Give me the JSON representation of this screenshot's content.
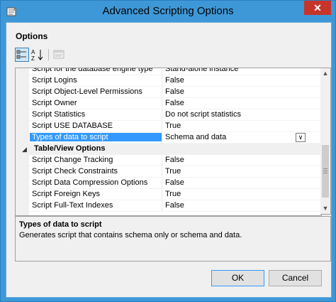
{
  "window": {
    "title": "Advanced Scripting Options",
    "close_label": "✕"
  },
  "options": {
    "section_title": "Options"
  },
  "toolbar": {
    "categorized_icon": "categorized-icon",
    "alphabetical_icon": "alphabetical-sort-icon",
    "property_pages_icon": "property-pages-icon"
  },
  "grid": {
    "rows": [
      {
        "type": "property",
        "name": "Script for the database engine type",
        "value": "Stand-alone instance"
      },
      {
        "type": "property",
        "name": "Script Logins",
        "value": "False"
      },
      {
        "type": "property",
        "name": "Script Object-Level Permissions",
        "value": "False"
      },
      {
        "type": "property",
        "name": "Script Owner",
        "value": "False"
      },
      {
        "type": "property",
        "name": "Script Statistics",
        "value": "Do not script statistics"
      },
      {
        "type": "property",
        "name": "Script USE DATABASE",
        "value": "True"
      },
      {
        "type": "property",
        "name": "Types of data to script",
        "value": "Schema and data",
        "selected": true
      },
      {
        "type": "category",
        "name": "Table/View Options",
        "toggle": "◢"
      },
      {
        "type": "property",
        "name": "Script Change Tracking",
        "value": "False"
      },
      {
        "type": "property",
        "name": "Script Check Constraints",
        "value": "True"
      },
      {
        "type": "property",
        "name": "Script Data Compression Options",
        "value": "False"
      },
      {
        "type": "property",
        "name": "Script Foreign Keys",
        "value": "True"
      },
      {
        "type": "property",
        "name": "Script Full-Text Indexes",
        "value": "False"
      }
    ],
    "dropdown_glyph": "∨"
  },
  "scrollbar": {
    "up_glyph": "▲",
    "down_glyph": "▼"
  },
  "description": {
    "title": "Types of data to script",
    "text": "Generates script that contains schema only or schema and data."
  },
  "buttons": {
    "ok": "OK",
    "cancel": "Cancel"
  },
  "colors": {
    "titlebar": "#3e98d7",
    "selection": "#3399ff",
    "close": "#c7352a"
  }
}
